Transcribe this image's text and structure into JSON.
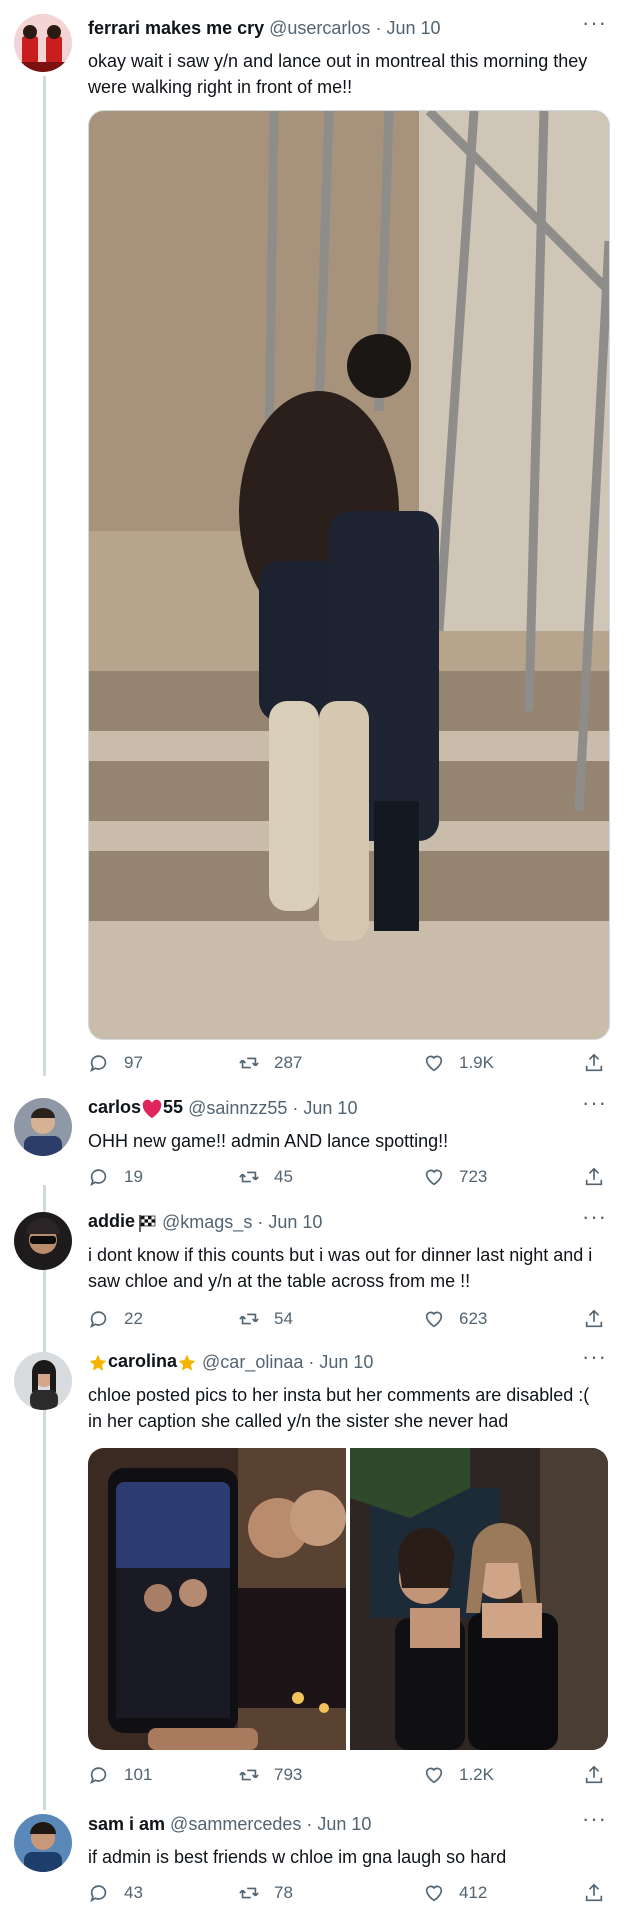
{
  "tweets": [
    {
      "name": "ferrari makes me cry",
      "handle": "@usercarlos",
      "sep": "·",
      "date": "Jun 10",
      "text": "okay wait i saw y/n and lance out in montreal this morning they were walking right in front of me!!",
      "replies": "97",
      "retweets": "287",
      "likes": "1.9K"
    },
    {
      "name_prefix": "carlos",
      "name_suffix": "55",
      "handle": "@sainnzz55",
      "sep": "·",
      "date": "Jun 10",
      "text": "OHH new game!! admin AND lance spotting!!",
      "replies": "19",
      "retweets": "45",
      "likes": "723"
    },
    {
      "name": "addie",
      "handle": "@kmags_s",
      "sep": "·",
      "date": "Jun 10",
      "text": "i dont know if this counts but i was out for dinner last night and i saw chloe and y/n at the table across from me !!",
      "replies": "22",
      "retweets": "54",
      "likes": "623"
    },
    {
      "name": "carolina",
      "handle": "@car_olinaa",
      "sep": "·",
      "date": "Jun 10",
      "text": "chloe posted pics to her insta but her comments are disabled :( in her caption she called y/n the sister she never had",
      "replies": "101",
      "retweets": "793",
      "likes": "1.2K"
    },
    {
      "name": "sam i am",
      "handle": "@sammercedes",
      "sep": "·",
      "date": "Jun 10",
      "text": "if admin is best friends w chloe im gna laugh so hard",
      "replies": "43",
      "retweets": "78",
      "likes": "412"
    }
  ],
  "more_glyph": "···",
  "colors": {
    "accent_heart": "#e0245e",
    "star": "#f4b400",
    "secondary": "#536471"
  }
}
